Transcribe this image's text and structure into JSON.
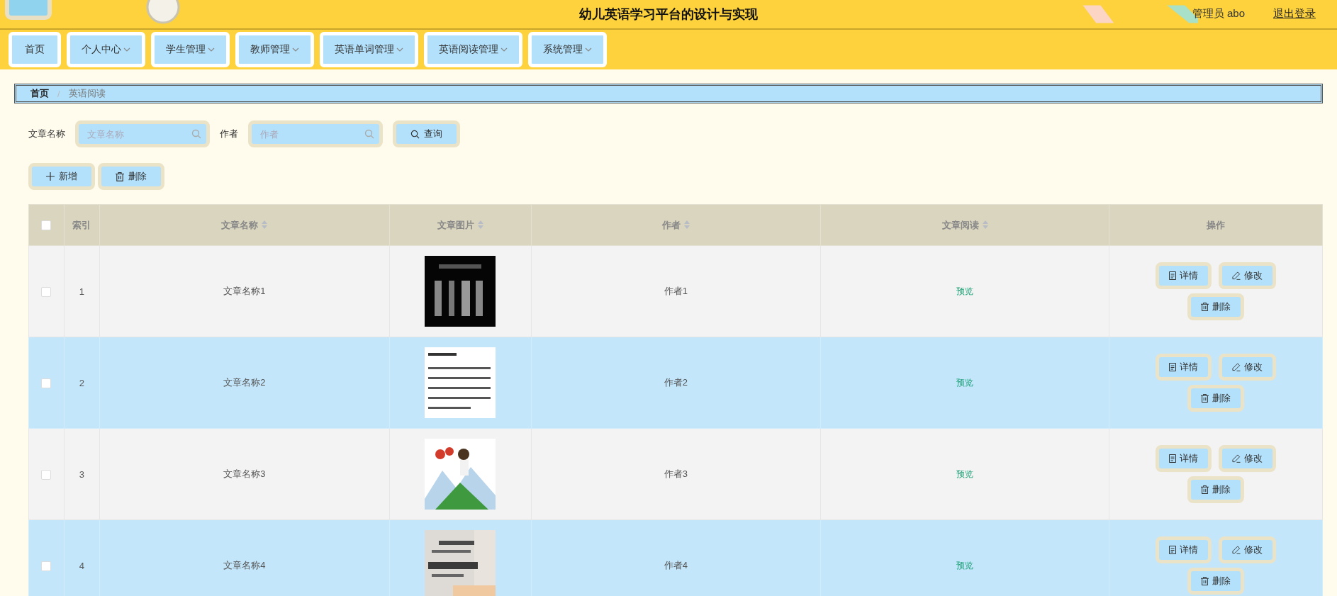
{
  "header": {
    "title": "幼儿英语学习平台的设计与实现",
    "user": "管理员 abo",
    "logout": "退出登录"
  },
  "nav": [
    {
      "label": "首页",
      "dropdown": false
    },
    {
      "label": "个人中心",
      "dropdown": true
    },
    {
      "label": "学生管理",
      "dropdown": true
    },
    {
      "label": "教师管理",
      "dropdown": true
    },
    {
      "label": "英语单词管理",
      "dropdown": true
    },
    {
      "label": "英语阅读管理",
      "dropdown": true
    },
    {
      "label": "系统管理",
      "dropdown": true
    }
  ],
  "breadcrumb": [
    {
      "label": "首页",
      "current": false
    },
    {
      "label": "英语阅读",
      "current": true
    }
  ],
  "breadcrumb_separator": "/",
  "search": {
    "fields": [
      {
        "label": "文章名称",
        "placeholder": "文章名称"
      },
      {
        "label": "作者",
        "placeholder": "作者"
      }
    ],
    "button": "查询"
  },
  "actions": [
    {
      "kind": "add",
      "label": "新增"
    },
    {
      "kind": "delete",
      "label": "删除"
    }
  ],
  "table": {
    "select_all": {
      "checked": false
    },
    "columns": [
      {
        "label": "索引",
        "sortable": false
      },
      {
        "label": "文章名称",
        "sortable": true
      },
      {
        "label": "文章图片",
        "sortable": true
      },
      {
        "label": "作者",
        "sortable": true
      },
      {
        "label": "文章阅读",
        "sortable": true
      },
      {
        "label": "操作",
        "sortable": false
      }
    ],
    "rows": [
      {
        "checked": false,
        "index": "1",
        "name": "文章名称1",
        "author": "作者1",
        "reading": "预览",
        "ops": [
          {
            "kind": "detail",
            "label": "详情"
          },
          {
            "kind": "edit",
            "label": "修改"
          },
          {
            "kind": "delete",
            "label": "删除"
          }
        ]
      },
      {
        "checked": false,
        "index": "2",
        "name": "文章名称2",
        "author": "作者2",
        "reading": "预览",
        "ops": [
          {
            "kind": "detail",
            "label": "详情"
          },
          {
            "kind": "edit",
            "label": "修改"
          },
          {
            "kind": "delete",
            "label": "删除"
          }
        ]
      },
      {
        "checked": false,
        "index": "3",
        "name": "文章名称3",
        "author": "作者3",
        "reading": "预览",
        "ops": [
          {
            "kind": "detail",
            "label": "详情"
          },
          {
            "kind": "edit",
            "label": "修改"
          },
          {
            "kind": "delete",
            "label": "删除"
          }
        ]
      },
      {
        "checked": false,
        "index": "4",
        "name": "文章名称4",
        "author": "作者4",
        "reading": "预览",
        "ops": [
          {
            "kind": "detail",
            "label": "详情"
          },
          {
            "kind": "edit",
            "label": "修改"
          },
          {
            "kind": "delete",
            "label": "删除"
          }
        ]
      }
    ]
  }
}
